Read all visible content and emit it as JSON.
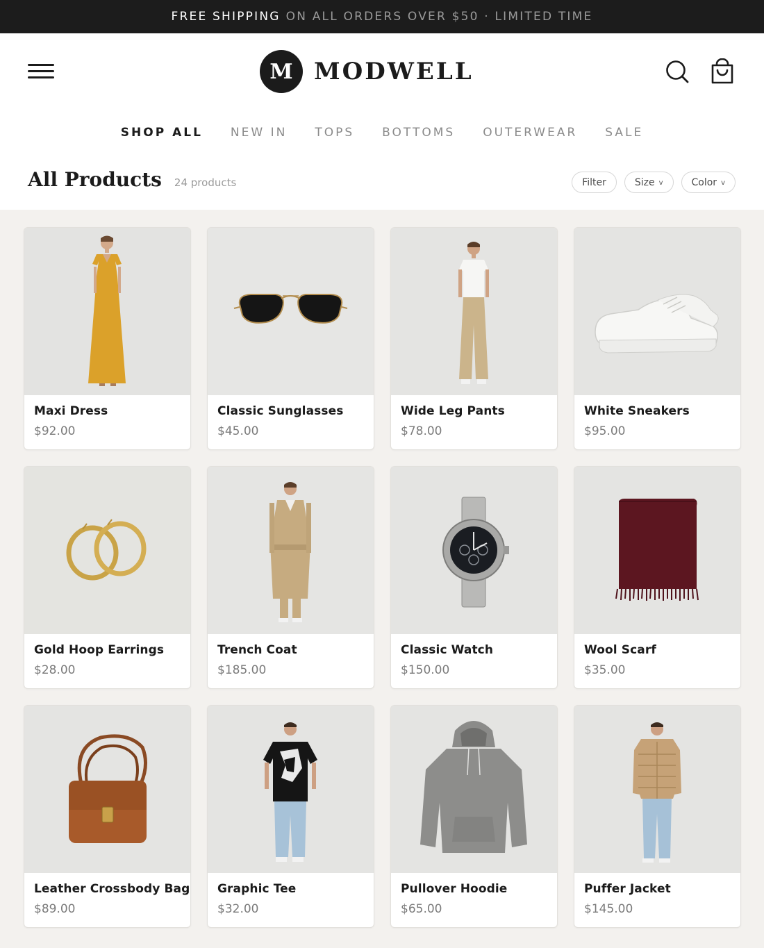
{
  "announcement": {
    "strong": "FREE SHIPPING",
    "rest": "ON ALL ORDERS OVER $50 · LIMITED TIME"
  },
  "header": {
    "logo_mark": "M",
    "logo_text": "MODWELL",
    "icons": [
      "menu-icon",
      "search-icon",
      "cart-icon"
    ]
  },
  "nav": {
    "items": [
      {
        "label": "SHOP ALL",
        "active": true
      },
      {
        "label": "NEW IN",
        "active": false
      },
      {
        "label": "TOPS",
        "active": false
      },
      {
        "label": "BOTTOMS",
        "active": false
      },
      {
        "label": "OUTERWEAR",
        "active": false
      },
      {
        "label": "SALE",
        "active": false
      }
    ]
  },
  "listing": {
    "title": "All Products",
    "count": "24 products",
    "filters": {
      "filter_label": "Filter",
      "size_label": "Size",
      "color_label": "Color"
    }
  },
  "products": [
    {
      "name": "Maxi Dress",
      "price": "$92.00",
      "image": "maxi-dress"
    },
    {
      "name": "Classic Sunglasses",
      "price": "$45.00",
      "image": "sunglasses"
    },
    {
      "name": "Wide Leg Pants",
      "price": "$78.00",
      "image": "wide-leg-pants"
    },
    {
      "name": "White Sneakers",
      "price": "$95.00",
      "image": "sneakers"
    },
    {
      "name": "Gold Hoop Earrings",
      "price": "$28.00",
      "image": "hoop-earrings"
    },
    {
      "name": "Trench Coat",
      "price": "$185.00",
      "image": "trench-coat"
    },
    {
      "name": "Classic Watch",
      "price": "$150.00",
      "image": "watch"
    },
    {
      "name": "Wool Scarf",
      "price": "$35.00",
      "image": "scarf"
    },
    {
      "name": "Leather Crossbody Bag",
      "price": "$89.00",
      "image": "crossbody-bag"
    },
    {
      "name": "Graphic Tee",
      "price": "$32.00",
      "image": "graphic-tee"
    },
    {
      "name": "Pullover Hoodie",
      "price": "$65.00",
      "image": "hoodie"
    },
    {
      "name": "Puffer Jacket",
      "price": "$145.00",
      "image": "puffer-jacket"
    }
  ],
  "colors": {
    "announcement_bg": "#1c1c1c",
    "grid_bg": "#f3f1ee",
    "text_primary": "#1b1b1b",
    "text_muted": "#7b7b7b"
  }
}
